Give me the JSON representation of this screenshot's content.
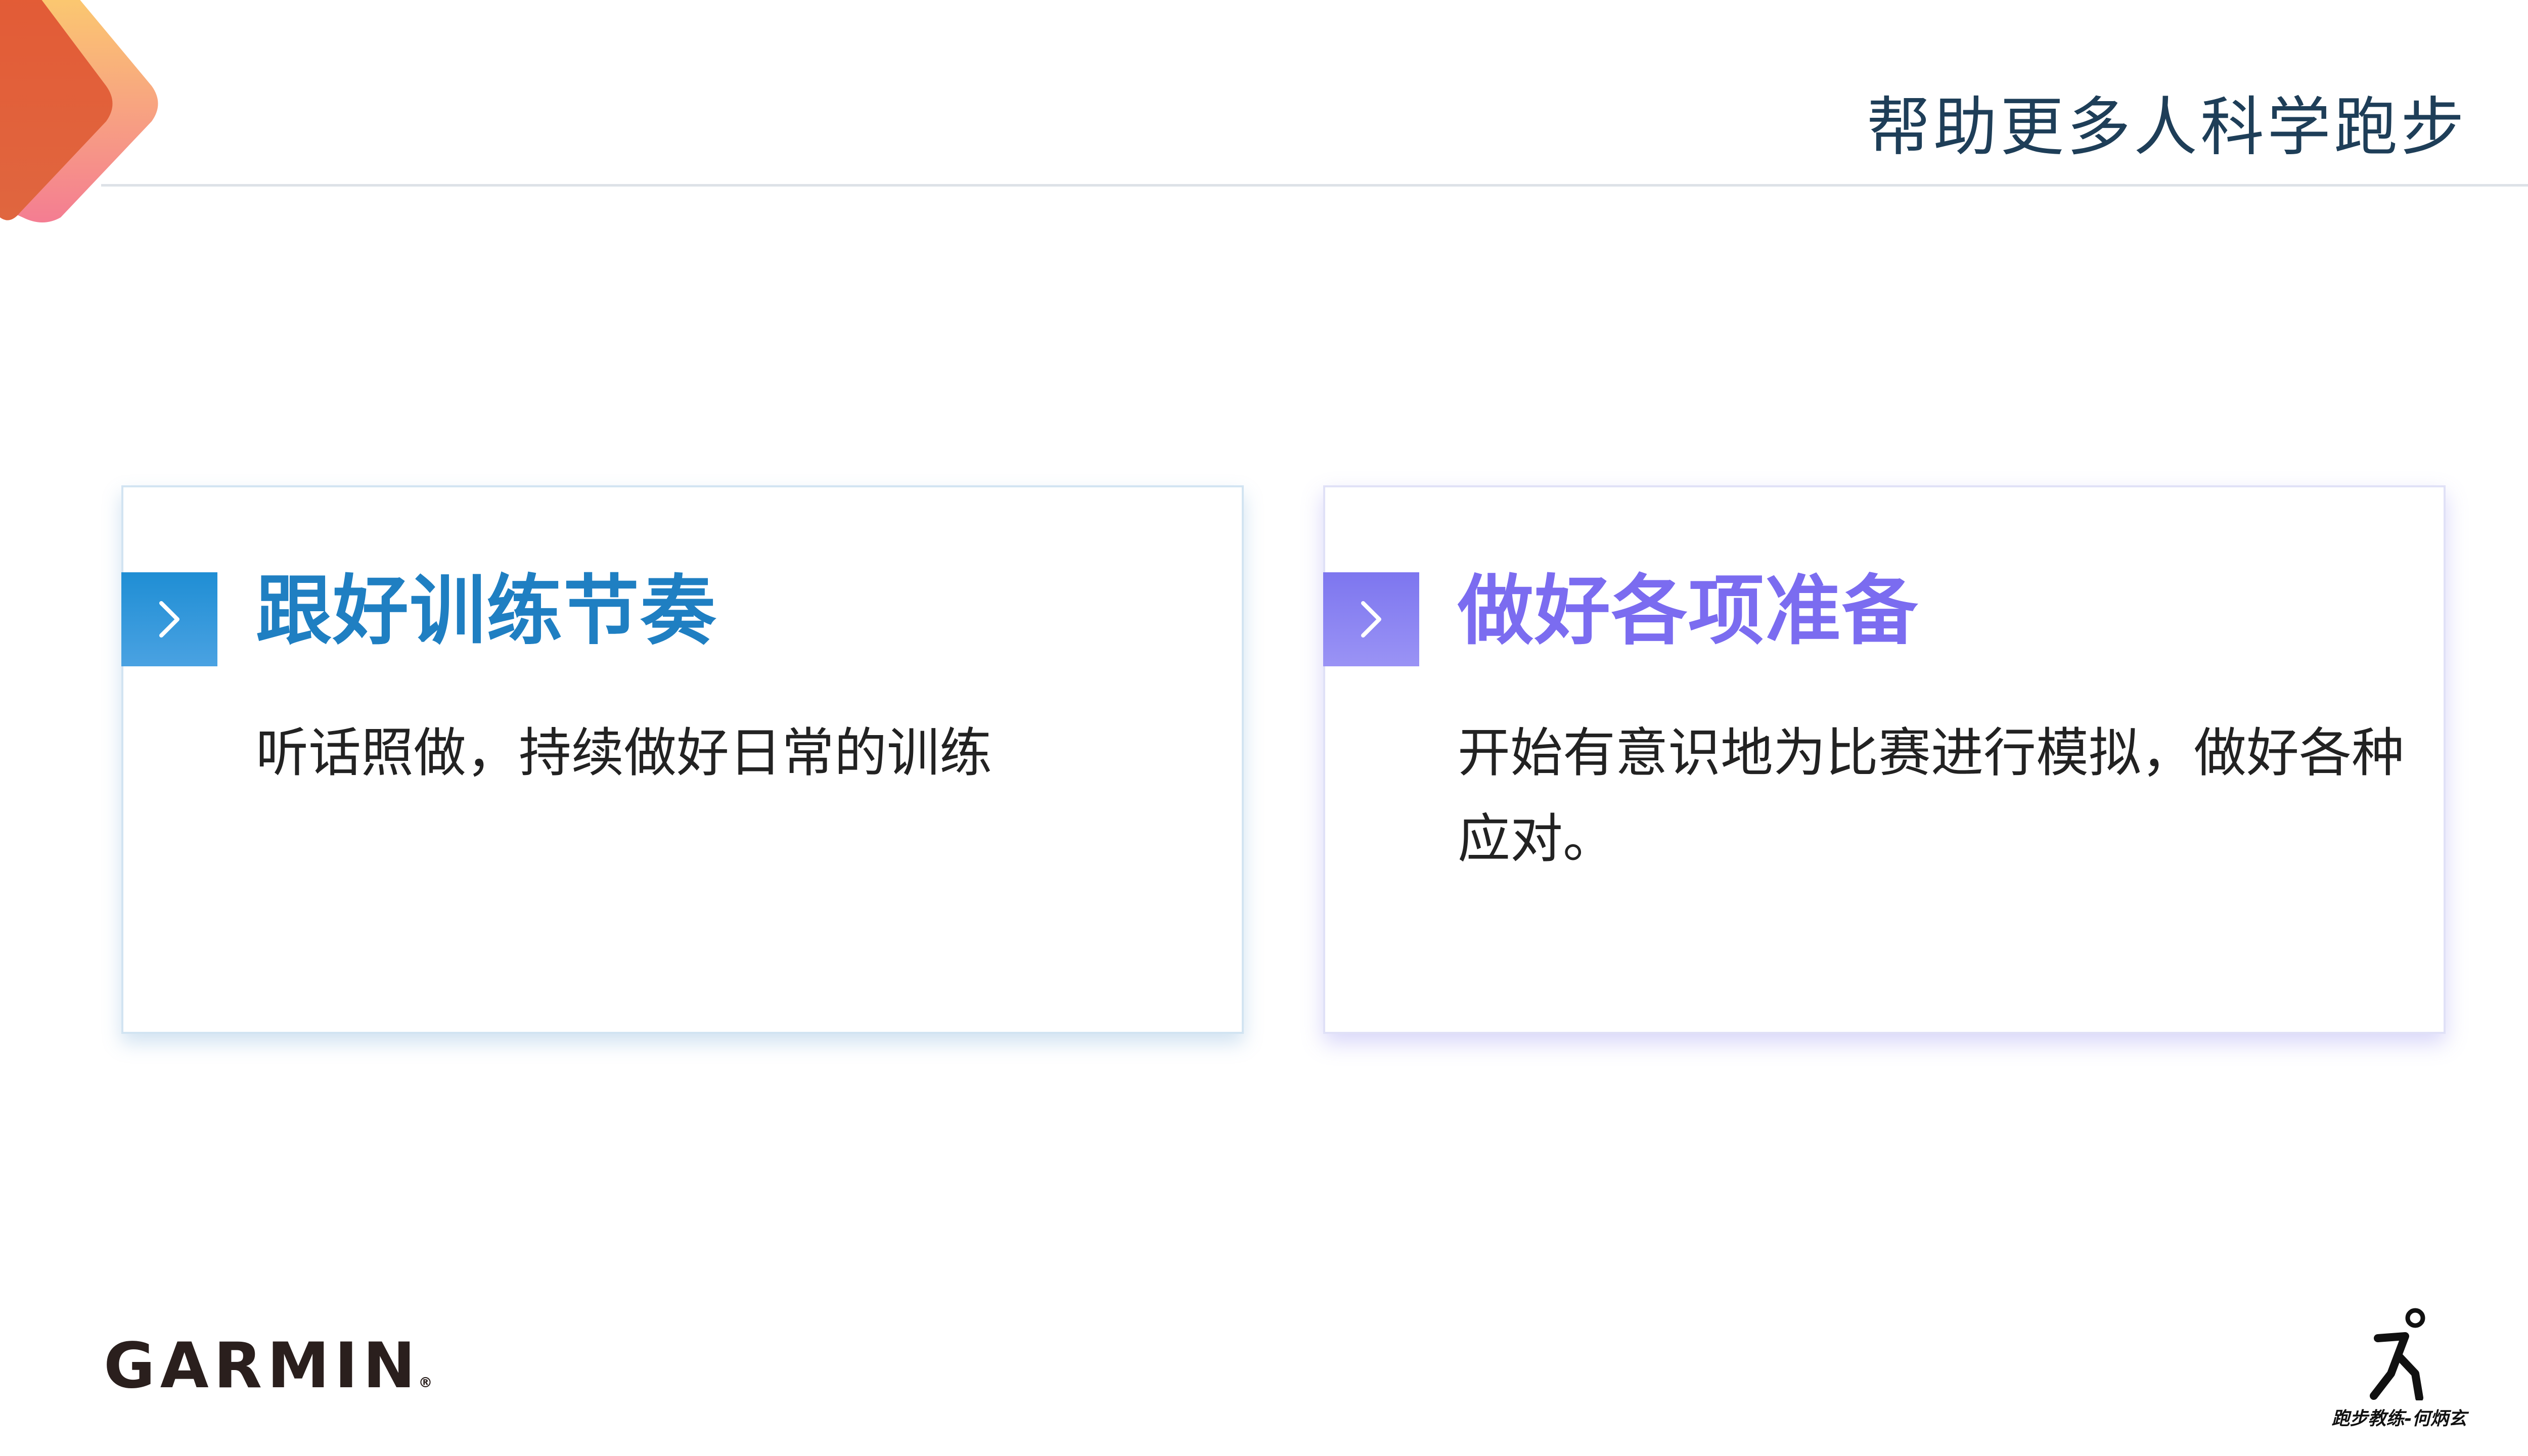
{
  "header": {
    "title": "帮助更多人科学跑步"
  },
  "cards": [
    {
      "title": "跟好训练节奏",
      "body": "听话照做，持续做好日常的训练"
    },
    {
      "title": "做好各项准备",
      "body": "开始有意识地为比赛进行模拟，做好各种应对。"
    }
  ],
  "footer": {
    "brand_logo": "GARMIN",
    "brand_registered": "®",
    "coach_caption": "跑步教练-何炳玄"
  },
  "colors": {
    "header_text": "#1e3e58",
    "card1_accent": "#1f7fc2",
    "card2_accent": "#7b6cf0",
    "deco_orange": "#e0603a",
    "deco_yellow": "#fcd36b",
    "deco_pink": "#f47d92"
  },
  "icons": {
    "card_marker": "chevron-right-icon",
    "coach_logo": "runner-icon"
  }
}
